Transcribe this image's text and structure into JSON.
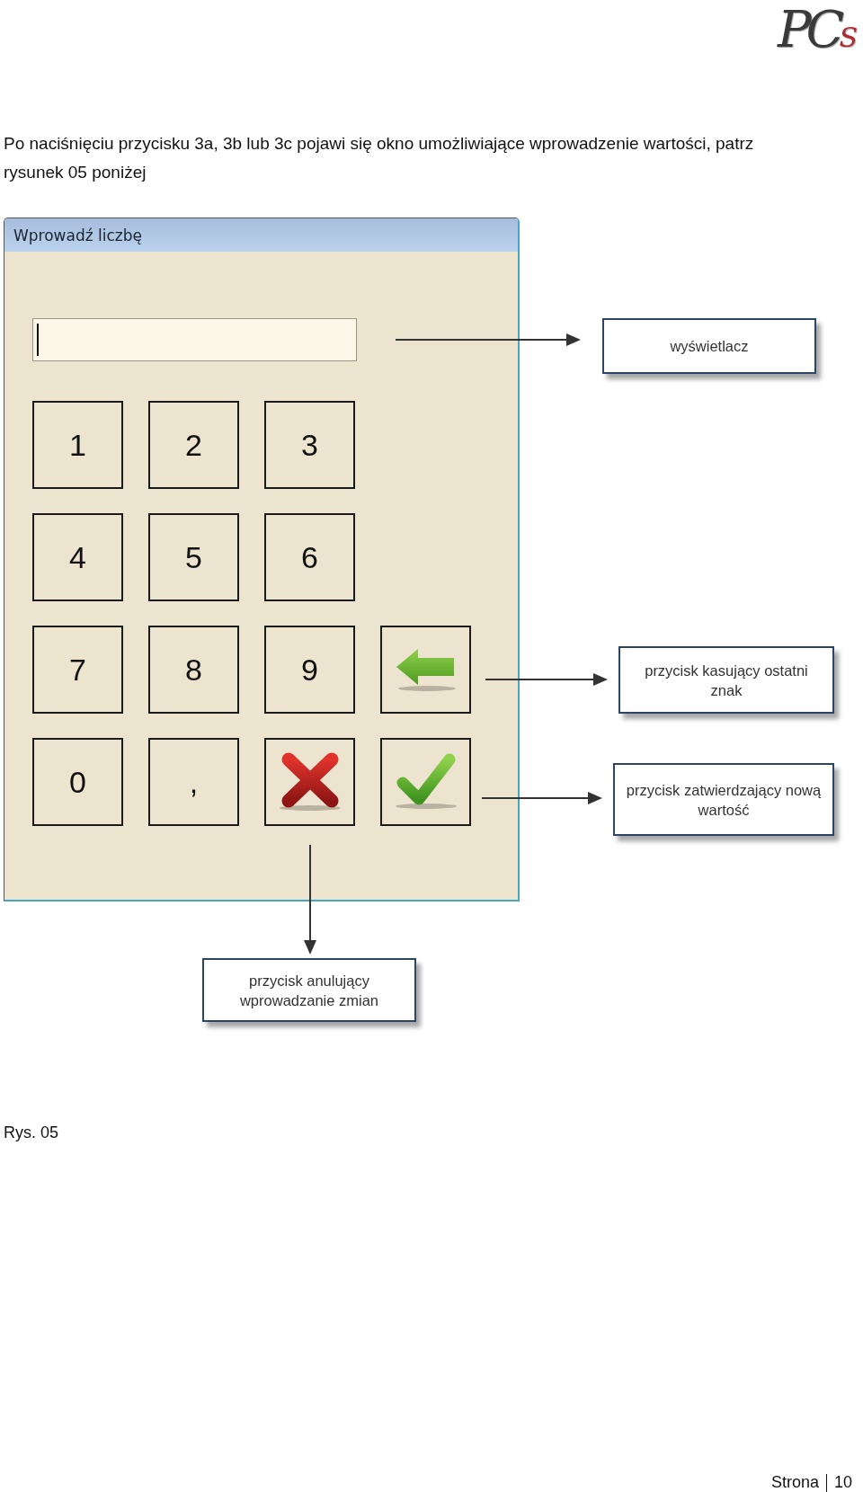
{
  "logo": {
    "text": "PC",
    "accent": "S"
  },
  "intro": "Po naciśnięciu przycisku 3a, 3b lub 3c pojawi się okno umożliwiające wprowadzenie wartości, patrz rysunek 05 poniżej",
  "window": {
    "title": "Wprowadź liczbę",
    "display": {
      "focused": true
    },
    "keypad_rows": [
      [
        {
          "kind": "key",
          "label": "1"
        },
        {
          "kind": "key",
          "label": "2"
        },
        {
          "kind": "key",
          "label": "3"
        }
      ],
      [
        {
          "kind": "key",
          "label": "4"
        },
        {
          "kind": "key",
          "label": "5"
        },
        {
          "kind": "key",
          "label": "6"
        }
      ],
      [
        {
          "kind": "key",
          "label": "7"
        },
        {
          "kind": "key",
          "label": "8"
        },
        {
          "kind": "key",
          "label": "9"
        },
        {
          "kind": "backspace"
        }
      ],
      [
        {
          "kind": "key",
          "label": "0"
        },
        {
          "kind": "key",
          "label": ","
        },
        {
          "kind": "cancel"
        },
        {
          "kind": "confirm"
        }
      ]
    ]
  },
  "callouts": [
    {
      "text": "wyświetlacz",
      "kind": "right"
    },
    {
      "text": "przycisk kasujący ostatni znak",
      "kind": "right"
    },
    {
      "text": "przycisk zatwierdzający nową wartość",
      "kind": "right"
    },
    {
      "text": "przycisk anulujący wprowadzanie zmian",
      "kind": "down"
    }
  ],
  "caption": "Rys. 05",
  "footer": {
    "label": "Strona",
    "page": "10"
  }
}
